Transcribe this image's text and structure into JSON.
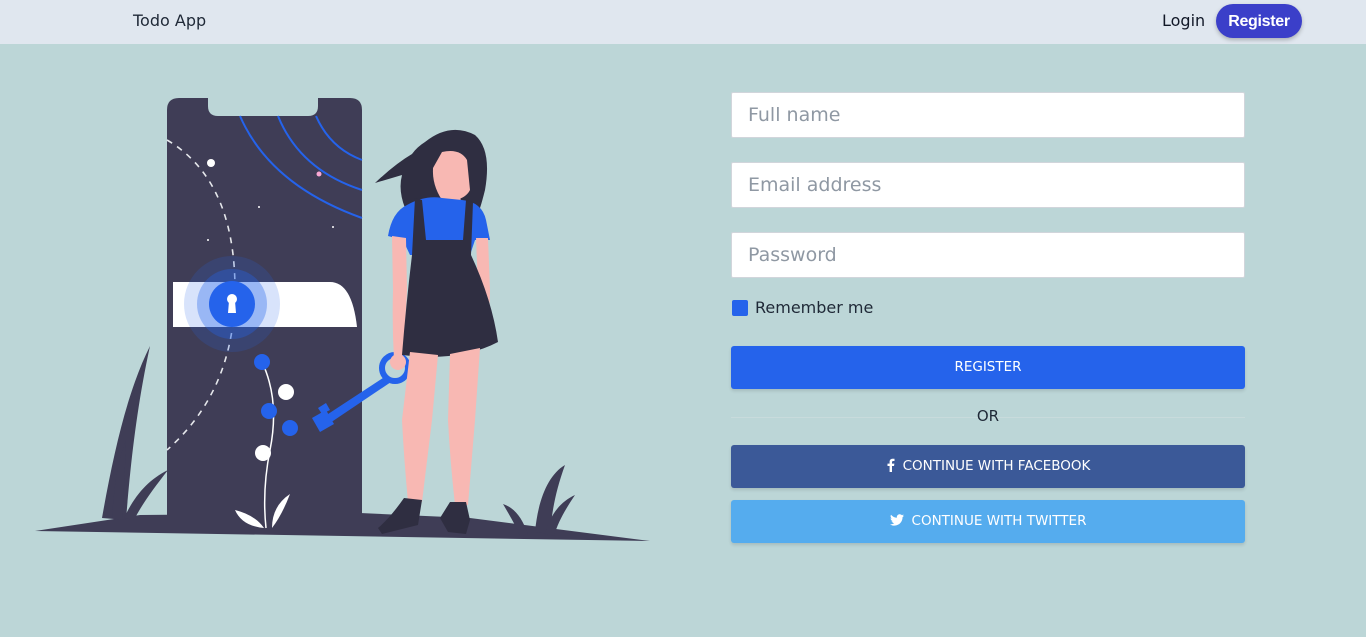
{
  "navbar": {
    "brand": "Todo App",
    "login_label": "Login",
    "register_label": "Register"
  },
  "form": {
    "full_name_placeholder": "Full name",
    "email_placeholder": "Email address",
    "password_placeholder": "Password",
    "remember_label": "Remember me",
    "remember_checked": true,
    "register_button": "REGISTER",
    "or_label": "OR",
    "facebook_button": "CONTINUE WITH FACEBOOK",
    "twitter_button": "CONTINUE WITH TWITTER"
  },
  "icons": {
    "facebook": "facebook-icon",
    "twitter": "twitter-icon",
    "keyhole": "keyhole-icon"
  },
  "colors": {
    "background": "#bcd6d7",
    "navbar": "#e0e7ef",
    "nav_register": "#3b3fc9",
    "primary": "#2563eb",
    "facebook": "#3b5998",
    "twitter": "#55acee",
    "phone": "#3f3d56"
  }
}
